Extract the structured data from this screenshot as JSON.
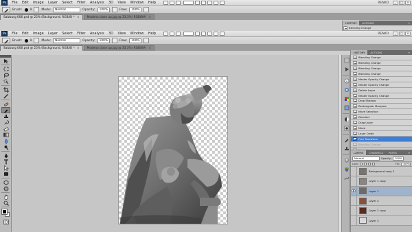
{
  "menubar": {
    "logo": "Ps",
    "items": [
      "File",
      "Edit",
      "Image",
      "Layer",
      "Select",
      "Filter",
      "Analysis",
      "3D",
      "View",
      "Window",
      "Help"
    ],
    "workspace": "RENKO"
  },
  "options_bar": {
    "brush_label": "Brush:",
    "brush_size": "9",
    "mode_label": "Mode:",
    "mode_value": "Normal",
    "opacity_label": "Opacity:",
    "opacity_value": "100%",
    "flow_label": "Flow:",
    "flow_value": "100%"
  },
  "tabs": [
    {
      "label": "Salzburg 006.psd @ 25% (Background, RGB/8) *",
      "active": true
    },
    {
      "label": "Modena close up.jpg @ 33,3% (RGB/8#)",
      "active": false
    }
  ],
  "top_history": {
    "tabs": [
      "HISTORY",
      "ACTIONS"
    ],
    "row": "Blending Change"
  },
  "history": {
    "tabs": [
      "HISTORY",
      "ACTIONS"
    ],
    "items": [
      {
        "label": "Blending Change",
        "state": "past"
      },
      {
        "label": "Blending Change",
        "state": "past"
      },
      {
        "label": "Blending Change",
        "state": "past"
      },
      {
        "label": "Blending Change",
        "state": "past"
      },
      {
        "label": "Master Opacity Change",
        "state": "past"
      },
      {
        "label": "Master Opacity Change",
        "state": "past"
      },
      {
        "label": "Delete Layer",
        "state": "past"
      },
      {
        "label": "Master Opacity Change",
        "state": "past"
      },
      {
        "label": "Drop Shadow",
        "state": "past"
      },
      {
        "label": "Rectangular Marquee",
        "state": "past"
      },
      {
        "label": "Move Selection",
        "state": "past"
      },
      {
        "label": "Deselect",
        "state": "past"
      },
      {
        "label": "Drag Layer",
        "state": "past"
      },
      {
        "label": "Move",
        "state": "past"
      },
      {
        "label": "Layer Order",
        "state": "past"
      },
      {
        "label": "Free Transform",
        "state": "current"
      },
      {
        "label": "Blending Change",
        "state": "future"
      },
      {
        "label": "Brush Tool",
        "state": "future"
      }
    ]
  },
  "layers": {
    "tabs": [
      "LAYERS",
      "CHANNELS",
      "PATHS"
    ],
    "blend_mode": "Normal",
    "opacity_label": "Opacity:",
    "opacity_value": "100%",
    "lock_label": "Lock:",
    "fill_label": "Fill:",
    "fill_value": "100%",
    "items": [
      {
        "name": "Background copy 2",
        "visible": false,
        "thumb": "#7a746e"
      },
      {
        "name": "Layer 1 copy",
        "visible": false,
        "thumb": "#8a8580"
      },
      {
        "name": "Layer 1",
        "visible": true,
        "thumb": "#6f6a66"
      },
      {
        "name": "Layer 4",
        "visible": false,
        "thumb": "#8b4f3a"
      },
      {
        "name": "Layer 2 copy",
        "visible": false,
        "thumb": "#5a2a1e"
      },
      {
        "name": "Layer 3",
        "visible": false,
        "thumb": "#d8d8d8"
      }
    ]
  },
  "colors": {
    "selection": "#3d7fd6",
    "canvas_bg": "#c6c6c6",
    "panel_bg": "#c9c9c9"
  },
  "icons": {
    "tools": [
      "move-icon",
      "marquee-icon",
      "lasso-icon",
      "quick-select-icon",
      "crop-icon",
      "eyedropper-icon",
      "healing-icon",
      "brush-icon",
      "clone-stamp-icon",
      "history-brush-icon",
      "eraser-icon",
      "gradient-icon",
      "blur-icon",
      "dodge-icon",
      "pen-icon",
      "type-icon",
      "path-select-icon",
      "shape-icon",
      "3d-rotate-icon",
      "3d-orbit-icon",
      "hand-icon",
      "zoom-icon"
    ],
    "dock": [
      "history-panel-icon",
      "actions-panel-icon",
      "info-panel-icon",
      "color-panel-icon",
      "swatches-panel-icon",
      "styles-panel-icon",
      "adjustments-panel-icon",
      "masks-panel-icon",
      "brushes-panel-icon",
      "clone-source-panel-icon",
      "layers-panel-icon",
      "channels-panel-icon",
      "paths-panel-icon"
    ]
  }
}
